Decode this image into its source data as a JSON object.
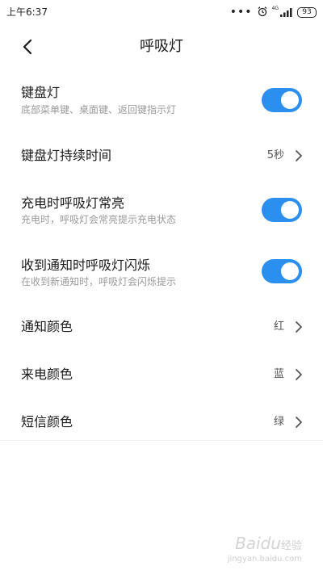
{
  "status_bar": {
    "time": "上午6:37",
    "dots": "•••",
    "network": "4G",
    "battery": "93"
  },
  "header": {
    "title": "呼吸灯"
  },
  "settings": [
    {
      "title": "键盘灯",
      "subtitle": "底部菜单键、桌面键、返回键指示灯",
      "toggle": true
    },
    {
      "title": "键盘灯持续时间",
      "value": "5秒"
    },
    {
      "title": "充电时呼吸灯常亮",
      "subtitle": "充电时，呼吸灯会常亮提示充电状态",
      "toggle": true
    },
    {
      "title": "收到通知时呼吸灯闪烁",
      "subtitle": "在收到新通知时，呼吸灯会闪烁提示",
      "toggle": true
    },
    {
      "title": "通知颜色",
      "value": "红"
    },
    {
      "title": "来电颜色",
      "value": "蓝"
    },
    {
      "title": "短信颜色",
      "value": "绿"
    }
  ],
  "colors": {
    "accent": "#2b8ff0",
    "subtitle": "#9a9a9a"
  },
  "watermark": {
    "brand": "Baidu",
    "jingyan": "经验",
    "url": "jingyan.baidu.com"
  }
}
